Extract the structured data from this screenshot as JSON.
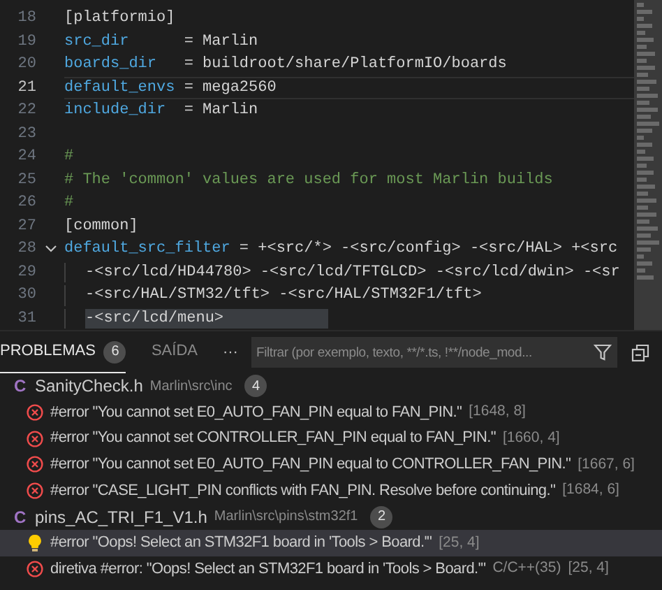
{
  "editor": {
    "lines": [
      {
        "number": "18",
        "current": false,
        "tokens": [
          {
            "kind": "plain",
            "text": "[platformio]"
          }
        ]
      },
      {
        "number": "19",
        "current": false,
        "tokens": [
          {
            "kind": "key",
            "text": "src_dir"
          },
          {
            "kind": "plain",
            "text": "      = Marlin"
          }
        ]
      },
      {
        "number": "20",
        "current": false,
        "tokens": [
          {
            "kind": "key",
            "text": "boards_dir"
          },
          {
            "kind": "plain",
            "text": "   = buildroot/share/PlatformIO/boards"
          }
        ]
      },
      {
        "number": "21",
        "current": true,
        "tokens": [
          {
            "kind": "key",
            "text": "default_envs"
          },
          {
            "kind": "plain",
            "text": " = mega2560"
          }
        ]
      },
      {
        "number": "22",
        "current": false,
        "tokens": [
          {
            "kind": "key",
            "text": "include_dir"
          },
          {
            "kind": "plain",
            "text": "  = Marlin"
          }
        ]
      },
      {
        "number": "23",
        "current": false
      },
      {
        "number": "24",
        "current": false,
        "tokens": [
          {
            "kind": "comment",
            "text": "#"
          }
        ]
      },
      {
        "number": "25",
        "current": false,
        "tokens": [
          {
            "kind": "comment",
            "text": "# The 'common' values are used for most Marlin builds"
          }
        ]
      },
      {
        "number": "26",
        "current": false,
        "tokens": [
          {
            "kind": "comment",
            "text": "#"
          }
        ]
      },
      {
        "number": "27",
        "current": false,
        "tokens": [
          {
            "kind": "plain",
            "text": "[common]"
          }
        ]
      },
      {
        "number": "28",
        "current": false,
        "expanded": true,
        "tokens": [
          {
            "kind": "key",
            "text": "default_src_filter"
          },
          {
            "kind": "plain",
            "text": " = +<src/*> -<src/config> -<src/HAL> +<src"
          }
        ]
      },
      {
        "number": "29",
        "current": false,
        "continuation": true,
        "tokens": [
          {
            "kind": "plain",
            "text": "-<src/lcd/HD44780> -<src/lcd/TFTGLCD> -<src/lcd/dwin> -<sr"
          }
        ]
      },
      {
        "number": "30",
        "current": false,
        "continuation": true,
        "tokens": [
          {
            "kind": "plain",
            "text": "-<src/HAL/STM32/tft> -<src/HAL/STM32F1/tft>"
          }
        ]
      },
      {
        "number": "31",
        "current": false,
        "continuation": true,
        "selected": true,
        "tokens": [
          {
            "kind": "plain",
            "text": "-<src/lcd/menu>"
          }
        ]
      }
    ]
  },
  "panel": {
    "tabs": [
      {
        "label": "PROBLEMAS",
        "count": "6",
        "selected": true
      },
      {
        "label": "SAÍDA",
        "selected": false
      }
    ],
    "more": "···",
    "filter": {
      "placeholder": "Filtrar (por exemplo, texto, **/*.ts, !**/node_mod..."
    },
    "groups": [
      {
        "icon": "C",
        "file": "SanityCheck.h",
        "path": "Marlin\\src\\inc",
        "count": "4",
        "items": [
          {
            "kind": "error",
            "selected": false,
            "message": "#error \"You cannot set E0_AUTO_FAN_PIN equal to FAN_PIN.\"",
            "location": "[1648, 8]"
          },
          {
            "kind": "error",
            "selected": false,
            "message": "#error \"You cannot set CONTROLLER_FAN_PIN equal to FAN_PIN.\"",
            "location": "[1660, 4]"
          },
          {
            "kind": "error",
            "selected": false,
            "message": "#error \"You cannot set E0_AUTO_FAN_PIN equal to CONTROLLER_FAN_PIN.\"",
            "location": "[1667, 6]"
          },
          {
            "kind": "error",
            "selected": false,
            "message": "#error \"CASE_LIGHT_PIN conflicts with FAN_PIN. Resolve before continuing.\"",
            "location": "[1684, 6]"
          }
        ]
      },
      {
        "icon": "C",
        "file": "pins_AC_TRI_F1_V1.h",
        "path": "Marlin\\src\\pins\\stm32f1",
        "count": "2",
        "items": [
          {
            "kind": "hint",
            "selected": true,
            "message": "#error \"Oops! Select an STM32F1 board in 'Tools > Board.'\"",
            "location": "[25, 4]"
          },
          {
            "kind": "error",
            "selected": false,
            "message": "diretiva #error: \"Oops! Select an STM32F1 board in 'Tools > Board.'\"",
            "source": "C/C++(35)",
            "location": "[25, 4]"
          }
        ]
      }
    ]
  }
}
